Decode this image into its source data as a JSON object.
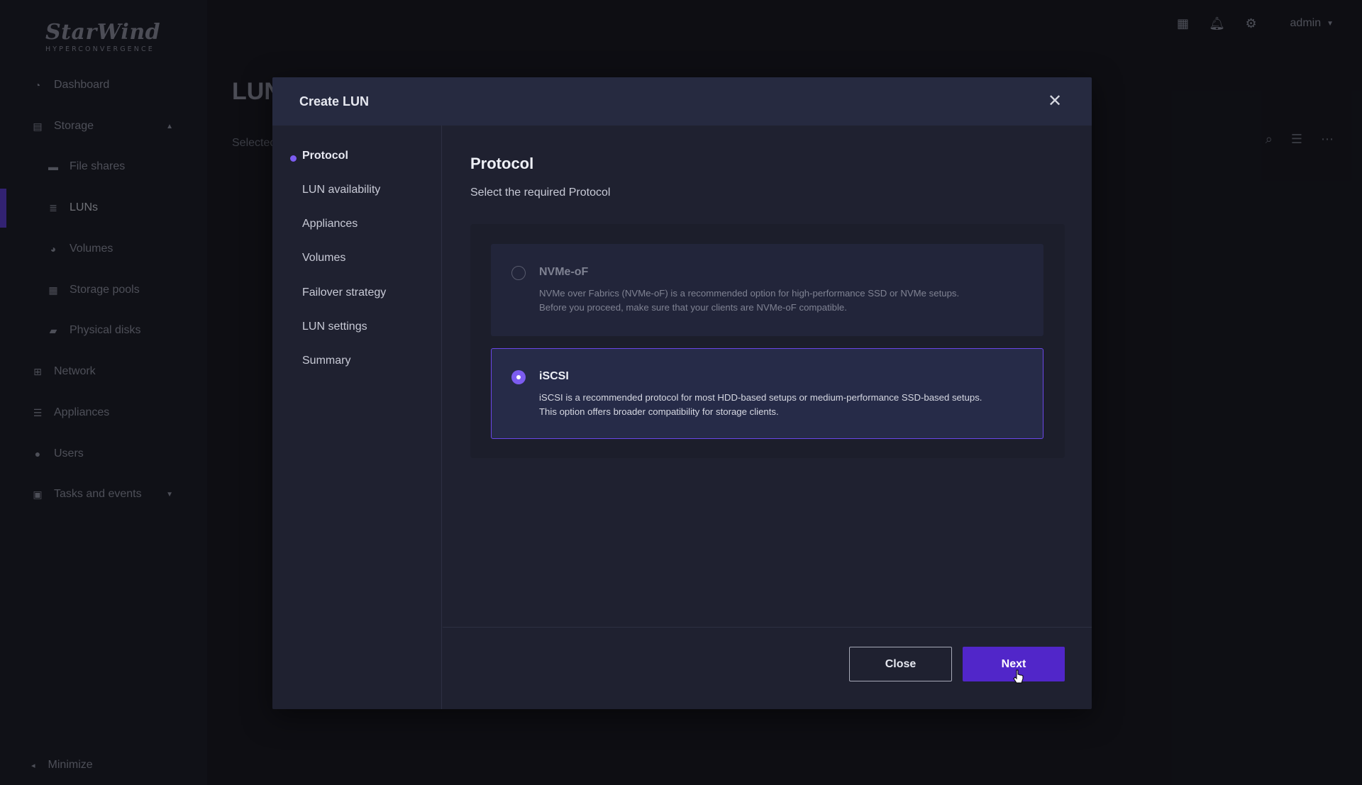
{
  "app": {
    "logo_text": "StarWind",
    "logo_sub": "HYPERCONVERGENCE",
    "user": "admin"
  },
  "sidebar": {
    "items": [
      {
        "label": "Dashboard",
        "icon": "dashboard-icon"
      },
      {
        "label": "Storage",
        "icon": "storage-icon"
      },
      {
        "label": "File shares",
        "icon": "file-shares-icon"
      },
      {
        "label": "LUNs",
        "icon": "luns-icon"
      },
      {
        "label": "Volumes",
        "icon": "volumes-icon"
      },
      {
        "label": "Storage pools",
        "icon": "storage-pools-icon"
      },
      {
        "label": "Physical disks",
        "icon": "physical-disks-icon"
      },
      {
        "label": "Network",
        "icon": "network-icon"
      },
      {
        "label": "Appliances",
        "icon": "appliances-icon"
      },
      {
        "label": "Users",
        "icon": "users-icon"
      },
      {
        "label": "Tasks and events",
        "icon": "tasks-icon"
      }
    ],
    "active": "LUNs",
    "minimize_label": "Minimize"
  },
  "page": {
    "title": "LUN",
    "subtitle": "Selectec"
  },
  "modal": {
    "title": "Create LUN",
    "steps": [
      "Protocol",
      "LUN availability",
      "Appliances",
      "Volumes",
      "Failover strategy",
      "LUN settings",
      "Summary"
    ],
    "current_step": "Protocol",
    "content_title": "Protocol",
    "content_subtitle": "Select the required Protocol",
    "options": [
      {
        "title": "NVMe-oF",
        "desc1": "NVMe over Fabrics (NVMe-oF) is a recommended option for high-performance SSD or NVMe setups.",
        "desc2": "Before you proceed, make sure that your clients are NVMe-oF compatible.",
        "selected": false
      },
      {
        "title": "iSCSI",
        "desc1": "iSCSI is a recommended protocol for most HDD-based setups or medium-performance SSD-based setups.",
        "desc2": "This option offers broader compatibility for storage clients.",
        "selected": true
      }
    ],
    "close_label": "Close",
    "next_label": "Next"
  },
  "colors": {
    "accent": "#5126c9",
    "accent_light": "#7c5cf0",
    "background": "#1a1b24",
    "modal": "#1f2130"
  }
}
